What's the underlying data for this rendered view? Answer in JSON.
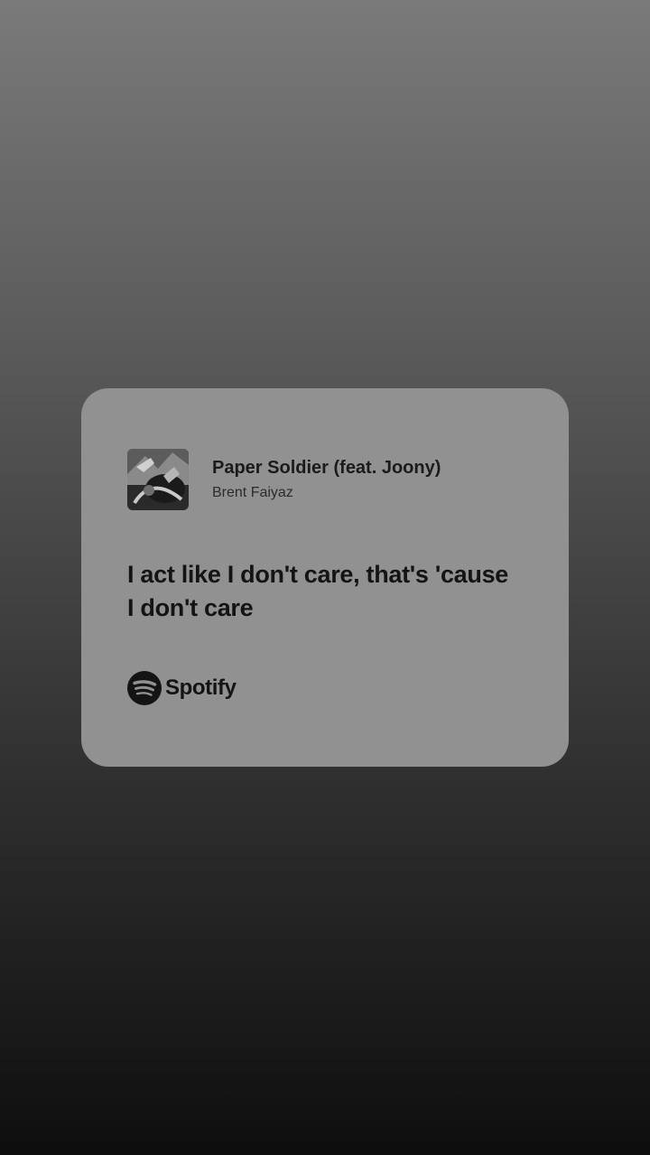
{
  "share_card": {
    "track": {
      "title": "Paper Soldier (feat. Joony)",
      "artist": "Brent Faiyaz",
      "cover_icon": "album-cover-image"
    },
    "lyrics": {
      "line_1": "I act like I don't care, that's 'cause",
      "line_2": "I don't care"
    },
    "brand": {
      "name": "Spotify",
      "icon": "spotify-logo-icon"
    }
  },
  "colors": {
    "background_top": "#7a7a7a",
    "background_bottom": "#0e0e0e",
    "card": "#919191",
    "text": "#141414"
  }
}
